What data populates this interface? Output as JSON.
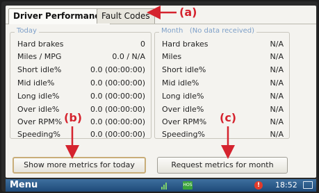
{
  "tabs": [
    {
      "label": "Driver Performance",
      "active": true
    },
    {
      "label": "Fault Codes",
      "active": false
    }
  ],
  "today": {
    "title": "Today",
    "rows": [
      {
        "label": "Hard brakes",
        "value": "0"
      },
      {
        "label": "Miles / MPG",
        "value": "0.0 / N/A"
      },
      {
        "label": "Short idle%",
        "value": "0.0 (00:00:00)"
      },
      {
        "label": "Mid idle%",
        "value": "0.0 (00:00:00)"
      },
      {
        "label": "Long idle%",
        "value": "0.0 (00:00:00)"
      },
      {
        "label": "Over idle%",
        "value": "0.0 (00:00:00)"
      },
      {
        "label": "Over RPM%",
        "value": "0.0 (00:00:00)"
      },
      {
        "label": "Speeding%",
        "value": "0.0 (00:00:00)"
      }
    ],
    "button": "Show more metrics for today"
  },
  "month": {
    "title": "Month   (No data received)",
    "rows": [
      {
        "label": "Hard brakes",
        "value": "N/A"
      },
      {
        "label": "Miles",
        "value": "N/A"
      },
      {
        "label": "Short idle%",
        "value": "N/A"
      },
      {
        "label": "Mid idle%",
        "value": "N/A"
      },
      {
        "label": "Long idle%",
        "value": "N/A"
      },
      {
        "label": "Over idle%",
        "value": "N/A"
      },
      {
        "label": "Over RPM%",
        "value": "N/A"
      },
      {
        "label": "Speeding%",
        "value": "N/A"
      }
    ],
    "button": "Request metrics for month"
  },
  "taskbar": {
    "menu": "Menu",
    "hos_label": "HOS",
    "alert": "!",
    "time": "18:52"
  },
  "annotations": {
    "a": "(a)",
    "b": "(b)",
    "c": "(c)"
  },
  "colors": {
    "accent_legend": "#7d9fc8",
    "annotation": "#d5232e",
    "taskbar": "#2a5a8a"
  }
}
